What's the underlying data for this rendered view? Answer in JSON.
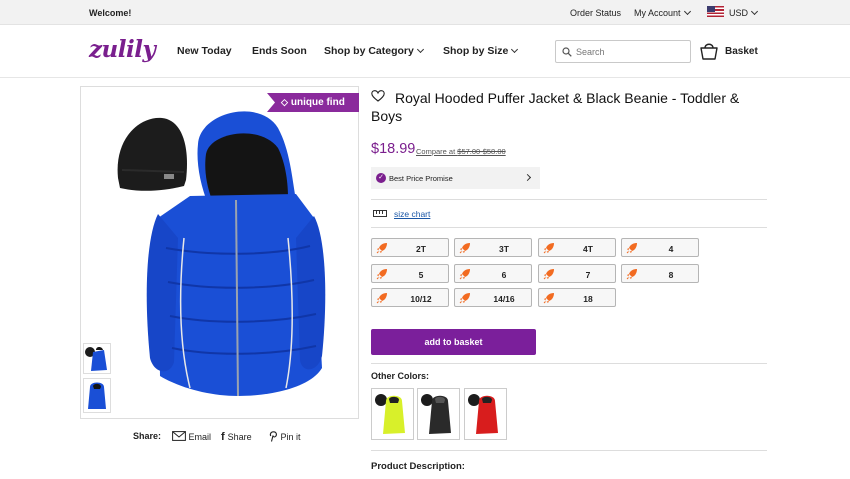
{
  "topbar": {
    "welcome": "Welcome!",
    "order_status": "Order Status",
    "my_account": "My Account",
    "currency": "USD"
  },
  "header": {
    "logo": "zulily",
    "nav": [
      "New Today",
      "Ends Soon",
      "Shop by Category",
      "Shop by Size"
    ],
    "search_placeholder": "Search",
    "basket": "Basket"
  },
  "product": {
    "ribbon": "unique find",
    "title": "Royal Hooded Puffer Jacket & Black Beanie - Toddler & Boys",
    "price": "$18.99",
    "compare_prefix": "Compare at ",
    "compare_value": "$57.00-$58.00",
    "best_price": "Best Price Promise",
    "size_chart": "size chart",
    "sizes": [
      "2T",
      "3T",
      "4T",
      "4",
      "5",
      "6",
      "7",
      "8",
      "10/12",
      "14/16",
      "18"
    ],
    "add_to_basket": "add to basket",
    "other_colors": "Other Colors:",
    "color_swatches": [
      "yellow-jacket",
      "black-jacket",
      "red-jacket"
    ],
    "product_description": "Product Description:"
  },
  "share": {
    "label": "Share:",
    "email": "Email",
    "facebook": "Share",
    "pinterest": "Pin it"
  },
  "colors": {
    "brand": "#7b1f8e",
    "jacket": "#1a4fd6",
    "rocket": "#f26b21"
  }
}
